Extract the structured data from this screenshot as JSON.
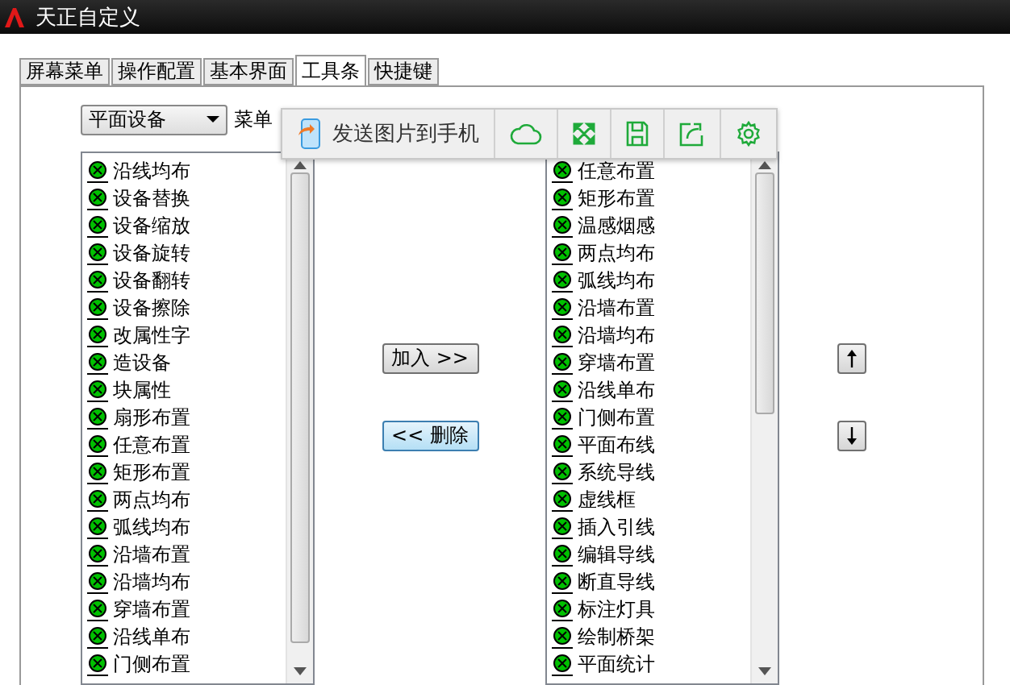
{
  "window": {
    "title": "天正自定义"
  },
  "tabs": [
    {
      "label": "屏幕菜单",
      "selected": false
    },
    {
      "label": "操作配置",
      "selected": false
    },
    {
      "label": "基本界面",
      "selected": false
    },
    {
      "label": "工具条",
      "selected": true
    },
    {
      "label": "快捷键",
      "selected": false
    }
  ],
  "menu_group": {
    "value": "平面设备",
    "label": "菜单"
  },
  "popup_toolbar": {
    "send_label": "发送图片到手机"
  },
  "available_list": [
    "沿线均布",
    "设备替换",
    "设备缩放",
    "设备旋转",
    "设备翻转",
    "设备擦除",
    "改属性字",
    "造设备",
    "块属性",
    "扇形布置",
    "任意布置",
    "矩形布置",
    "两点均布",
    "弧线均布",
    "沿墙布置",
    "沿墙均布",
    "穿墙布置",
    "沿线单布",
    "门侧布置"
  ],
  "add_button": "加入 >>",
  "remove_button": "<< 删除",
  "toolbar_list": [
    "任意布置",
    "矩形布置",
    "温感烟感",
    "两点均布",
    "弧线均布",
    "沿墙布置",
    "沿墙均布",
    "穿墙布置",
    "沿线单布",
    "门侧布置",
    "平面布线",
    "系统导线",
    "虚线框",
    "插入引线",
    "编辑导线",
    "断直导线",
    "标注灯具",
    "绘制桥架",
    "平面统计"
  ]
}
